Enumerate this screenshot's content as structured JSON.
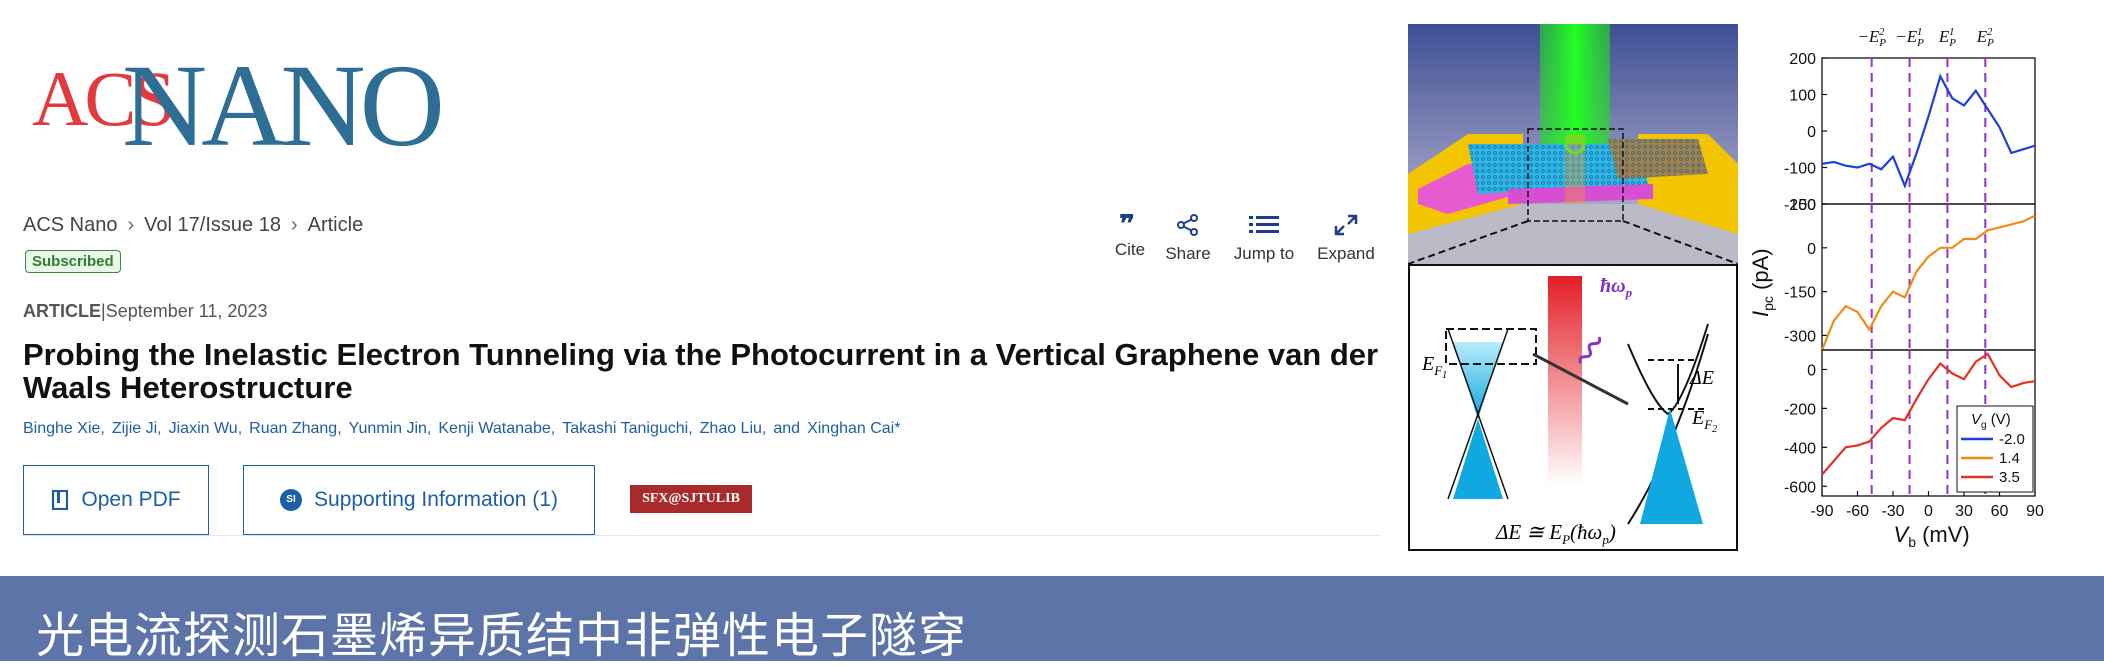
{
  "logo": {
    "acs": "ACS",
    "nano": "NANO"
  },
  "breadcrumb": [
    "ACS Nano",
    "Vol 17/Issue 18",
    "Article"
  ],
  "badge": "Subscribed",
  "tools": [
    {
      "label": "Cite",
      "icon": "quote-icon"
    },
    {
      "label": "Share",
      "icon": "share-icon"
    },
    {
      "label": "Jump to",
      "icon": "list-icon"
    },
    {
      "label": "Expand",
      "icon": "expand-icon"
    }
  ],
  "article": {
    "type": "ARTICLE",
    "sep": "|",
    "date": "September 11, 2023",
    "title": "Probing the Inelastic Electron Tunneling via the Photocurrent in a Vertical Graphene van der Waals Heterostructure",
    "authors": [
      "Binghe Xie,",
      "Zijie Ji,",
      "Jiaxin Wu,",
      "Ruan Zhang,",
      "Yunmin Jin,",
      "Kenji Watanabe,",
      "Takashi Taniguchi,",
      "Zhao Liu,",
      "and",
      "Xinghan Cai*"
    ]
  },
  "buttons": {
    "pdf": "Open PDF",
    "si_icon": "SI",
    "si": "Supporting Information (1)",
    "library": "SFX@SJTULIB"
  },
  "banner": "光电流探测石墨烯异质结中非弹性电子隧穿",
  "figure": {
    "schematic": {
      "ef1": "E",
      "ef1_sub": "F",
      "ef1_subsub": "1",
      "ef2": "E",
      "ef2_sub": "F",
      "ef2_subsub": "2",
      "delta": "ΔE",
      "photon": "ħω",
      "photon_sub": "p",
      "bottom": "ΔE ≅ E",
      "bottom_sub": "P",
      "bottom_tail": "(ħω",
      "bottom_tail_sub": "p",
      "bottom_close": ")"
    },
    "top_labels": [
      "−E",
      "−E",
      "E",
      "E"
    ],
    "top_sups": [
      "2",
      "1",
      "1",
      "2"
    ],
    "top_subs": [
      "P",
      "P",
      "P",
      "P"
    ],
    "ylabel": "I",
    "ylabel_sub": "pc",
    "ylabel_unit": " (pA)",
    "xlabel": "V",
    "xlabel_sub": "b",
    "xlabel_unit": " (mV)",
    "legend_title": "V",
    "legend_title_sub": "g",
    "legend_title_unit": " (V)",
    "colors": {
      "blue": "#1f3fd6",
      "orange": "#f08a18",
      "red": "#e8301f",
      "dash": "#9a2fd0"
    }
  },
  "chart_data": {
    "type": "line",
    "xlabel": "Vb (mV)",
    "ylabel": "Ipc (pA)",
    "x": [
      -90,
      -80,
      -70,
      -60,
      -50,
      -40,
      -30,
      -20,
      -10,
      0,
      10,
      20,
      30,
      40,
      50,
      60,
      70,
      80,
      90
    ],
    "x_ticks": [
      "-90",
      "-60",
      "-30",
      "0",
      "30",
      "60",
      "90"
    ],
    "xlim": [
      -90,
      90
    ],
    "vlines": [
      -48,
      -16,
      16,
      48
    ],
    "legend": {
      "title": "Vg (V)",
      "placement": "bottom-right"
    },
    "panels": [
      {
        "series": [
          {
            "name": "-2.0",
            "color": "#1f3fd6",
            "values": [
              -90,
              -85,
              -95,
              -100,
              -90,
              -105,
              -70,
              -150,
              -60,
              40,
              150,
              90,
              70,
              110,
              60,
              10,
              -60,
              -50,
              -40
            ]
          }
        ],
        "ylim": [
          -200,
          200
        ],
        "y_ticks": [
          "200",
          "100",
          "0",
          "-100",
          "-200"
        ]
      },
      {
        "series": [
          {
            "name": "1.4",
            "color": "#f08a18",
            "values": [
              -350,
              -250,
              -200,
              -220,
              -280,
              -200,
              -150,
              -170,
              -80,
              -30,
              0,
              0,
              30,
              30,
              60,
              70,
              80,
              90,
              110
            ]
          }
        ],
        "ylim": [
          -350,
          150
        ],
        "y_ticks": [
          "150",
          "0",
          "-150",
          "-300"
        ]
      },
      {
        "series": [
          {
            "name": "3.5",
            "color": "#e8301f",
            "values": [
              -540,
              -470,
              -400,
              -390,
              -370,
              -300,
              -250,
              -260,
              -150,
              -50,
              30,
              -20,
              -50,
              40,
              80,
              -30,
              -90,
              -70,
              -60
            ]
          }
        ],
        "ylim": [
          -650,
          100
        ],
        "y_ticks": [
          "0",
          "-200",
          "-400",
          "-600"
        ]
      }
    ]
  }
}
